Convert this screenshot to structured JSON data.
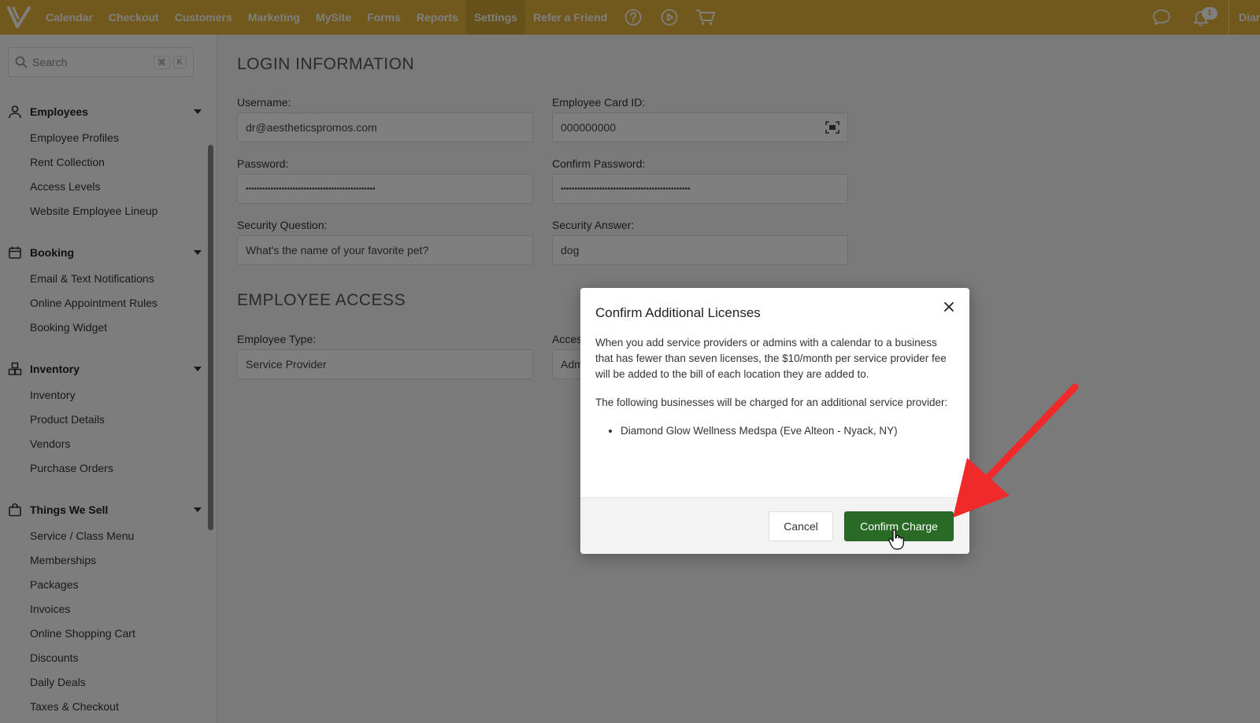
{
  "nav": {
    "items": [
      "Calendar",
      "Checkout",
      "Customers",
      "Marketing",
      "MySite",
      "Forms",
      "Reports",
      "Settings",
      "Refer a Friend"
    ],
    "active": "Settings",
    "notification_count": "1",
    "user_name_truncated": "Diam"
  },
  "sidebar": {
    "search_placeholder": "Search",
    "shortcut_cmd": "⌘",
    "shortcut_key": "K",
    "sections": [
      {
        "title": "Employees",
        "icon": "person-icon",
        "items": [
          "Employee Profiles",
          "Rent Collection",
          "Access Levels",
          "Website Employee Lineup"
        ]
      },
      {
        "title": "Booking",
        "icon": "calendar-icon",
        "items": [
          "Email & Text Notifications",
          "Online Appointment Rules",
          "Booking Widget"
        ]
      },
      {
        "title": "Inventory",
        "icon": "boxes-icon",
        "items": [
          "Inventory",
          "Product Details",
          "Vendors",
          "Purchase Orders"
        ]
      },
      {
        "title": "Things We Sell",
        "icon": "bag-icon",
        "items": [
          "Service / Class Menu",
          "Memberships",
          "Packages",
          "Invoices",
          "Online Shopping Cart",
          "Discounts",
          "Daily Deals",
          "Taxes & Checkout"
        ]
      }
    ]
  },
  "login": {
    "heading": "LOGIN INFORMATION",
    "username_label": "Username:",
    "username_value": "dr@aestheticspromos.com",
    "card_label": "Employee Card ID:",
    "card_value": "000000000",
    "password_label": "Password:",
    "password_value": "•••••••••••••••••••••••••••••••••••••••••••••••",
    "confirm_label": "Confirm Password:",
    "confirm_value": "•••••••••••••••••••••••••••••••••••••••••••••••",
    "question_label": "Security Question:",
    "question_value": "What's the name of your favorite pet?",
    "answer_label": "Security Answer:",
    "answer_value": "dog"
  },
  "access": {
    "heading": "EMPLOYEE ACCESS",
    "type_label": "Employee Type:",
    "type_value": "Service Provider",
    "level_label": "Acces",
    "level_value": "Adm"
  },
  "modal": {
    "title": "Confirm Additional Licenses",
    "para1": "When you add service providers or admins with a calendar to a business that has fewer than seven licenses, the $10/month per service provider fee will be added to the bill of each location they are added to.",
    "para2": "The following businesses will be charged for an additional service provider:",
    "businesses": [
      "Diamond Glow Wellness Medspa (Eve Alteon - Nyack, NY)"
    ],
    "cancel_label": "Cancel",
    "confirm_label": "Confirm Charge"
  },
  "colors": {
    "topbar": "#e3b13a",
    "confirm_button": "#2a6a27",
    "annotation_arrow": "#f02a2a"
  }
}
